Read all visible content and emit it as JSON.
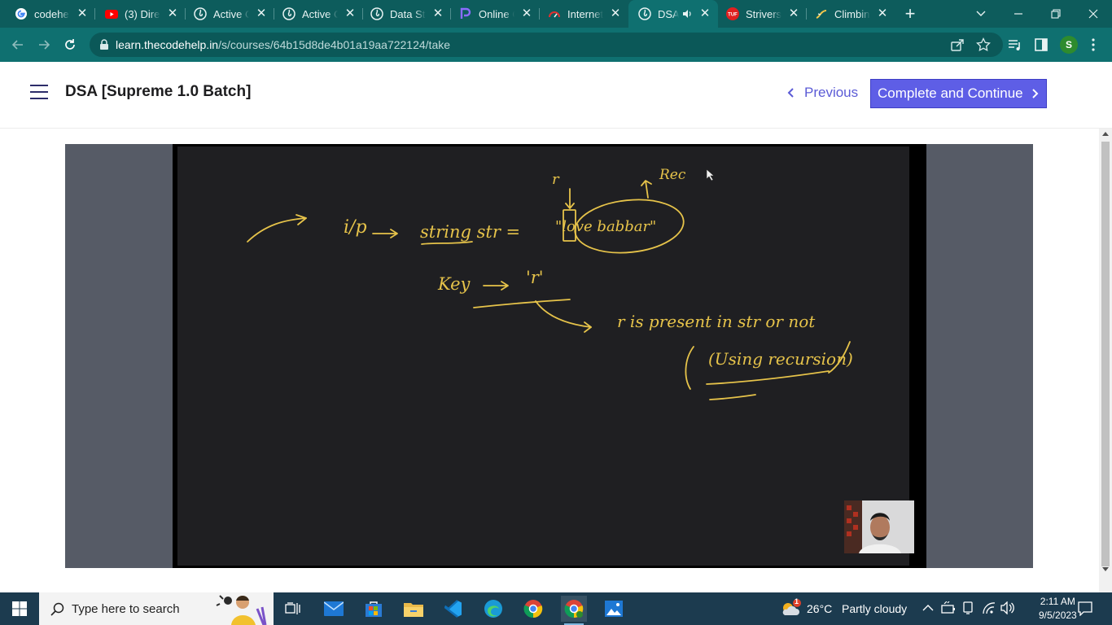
{
  "browser": {
    "tabs": [
      {
        "label": "codehelp",
        "icon": "google-icon",
        "active": false
      },
      {
        "label": "(3) Direct",
        "icon": "youtube-icon",
        "active": false
      },
      {
        "label": "Active C",
        "icon": "codehelp-icon",
        "active": false
      },
      {
        "label": "Active C",
        "icon": "codehelp-icon",
        "active": false
      },
      {
        "label": "Data Str",
        "icon": "codehelp-icon",
        "active": false
      },
      {
        "label": "Online C",
        "icon": "online-compiler-icon",
        "active": false
      },
      {
        "label": "Internet",
        "icon": "speedtest-icon",
        "active": false
      },
      {
        "label": "DSA",
        "icon": "codehelp-icon",
        "active": true,
        "audio": true
      },
      {
        "label": "Strivers",
        "icon": "tuf-icon",
        "active": false
      },
      {
        "label": "Climbing",
        "icon": "climbing-icon",
        "active": false
      }
    ],
    "address": {
      "host": "learn.thecodehelp.in",
      "path": "/s/courses/64b15d8de4b01a19aa722124/take"
    },
    "profile_initial": "S"
  },
  "page": {
    "course_title": "DSA [Supreme 1.0 Batch]",
    "previous_label": "Previous",
    "complete_label": "Complete and Continue"
  },
  "whiteboard": {
    "annotations": [
      "i/p",
      "string str =",
      "\"love babbar\"",
      "Key",
      "'r'",
      "r is present in str or not",
      "(Using recursion)",
      "Rec",
      "r"
    ],
    "ink_color": "#e6c34a"
  },
  "taskbar": {
    "search_placeholder": "Type here to search",
    "weather_temp": "26°C",
    "weather_text": "Partly cloudy",
    "weather_badge": "1",
    "time": "2:11 AM",
    "date": "9/5/2023"
  },
  "colors": {
    "tab_strip": "#0d5c5c",
    "toolbar": "#0f7070",
    "accent": "#5e5ee6",
    "taskbar": "#1c3b4f"
  }
}
